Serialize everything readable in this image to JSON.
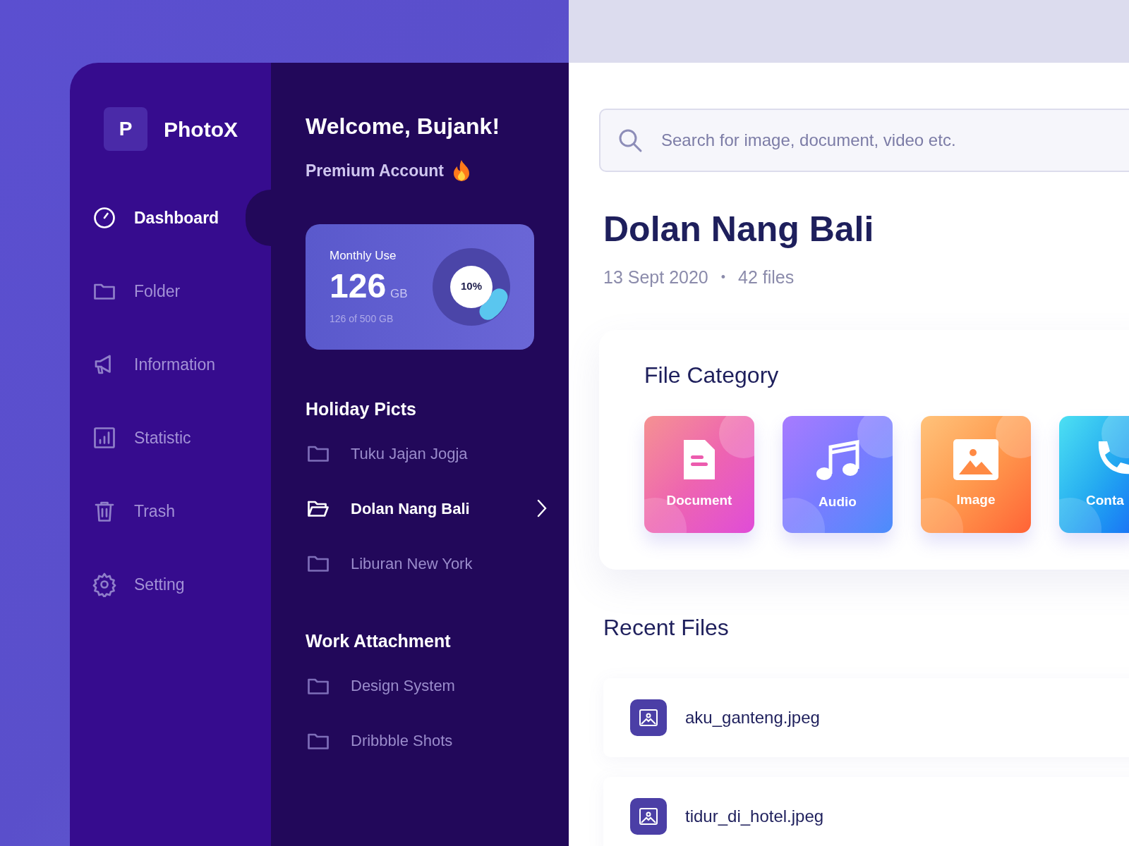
{
  "app": {
    "logo_letter": "P",
    "name": "PhotoX"
  },
  "nav": [
    {
      "label": "Dashboard",
      "kind": "gauge",
      "selected": true
    },
    {
      "label": "Folder",
      "kind": "folder",
      "selected": false
    },
    {
      "label": "Information",
      "kind": "megaphone",
      "selected": false
    },
    {
      "label": "Statistic",
      "kind": "chart",
      "selected": false
    },
    {
      "label": "Trash",
      "kind": "trash",
      "selected": false
    },
    {
      "label": "Setting",
      "kind": "gear",
      "selected": false
    }
  ],
  "welcome": {
    "title": "Welcome, Bujank!",
    "subtitle": "Premium Account"
  },
  "usage": {
    "label": "Monthly Use",
    "amount": "126",
    "unit": "GB",
    "detail": "126 of 500 GB",
    "percent": "10%"
  },
  "folder_groups": [
    {
      "title": "Holiday Picts",
      "folders": [
        {
          "name": "Tuku Jajan Jogja",
          "selected": false
        },
        {
          "name": "Dolan Nang Bali",
          "selected": true
        },
        {
          "name": "Liburan New York",
          "selected": false
        }
      ]
    },
    {
      "title": "Work Attachment",
      "folders": [
        {
          "name": "Design System",
          "selected": false
        },
        {
          "name": "Dribbble Shots",
          "selected": false
        }
      ]
    }
  ],
  "search": {
    "placeholder": "Search for image, document, video etc."
  },
  "album": {
    "title": "Dolan Nang Bali",
    "date": "13 Sept 2020",
    "separator": "•",
    "count": "42 files"
  },
  "file_category": {
    "title": "File Category",
    "items": [
      {
        "label": "Document",
        "kind": "document"
      },
      {
        "label": "Audio",
        "kind": "audio"
      },
      {
        "label": "Image",
        "kind": "image"
      },
      {
        "label": "Conta",
        "kind": "contact"
      }
    ]
  },
  "recent_files": {
    "title": "Recent Files",
    "files": [
      {
        "name": "aku_ganteng.jpeg"
      },
      {
        "name": "tidur_di_hotel.jpeg"
      }
    ]
  }
}
